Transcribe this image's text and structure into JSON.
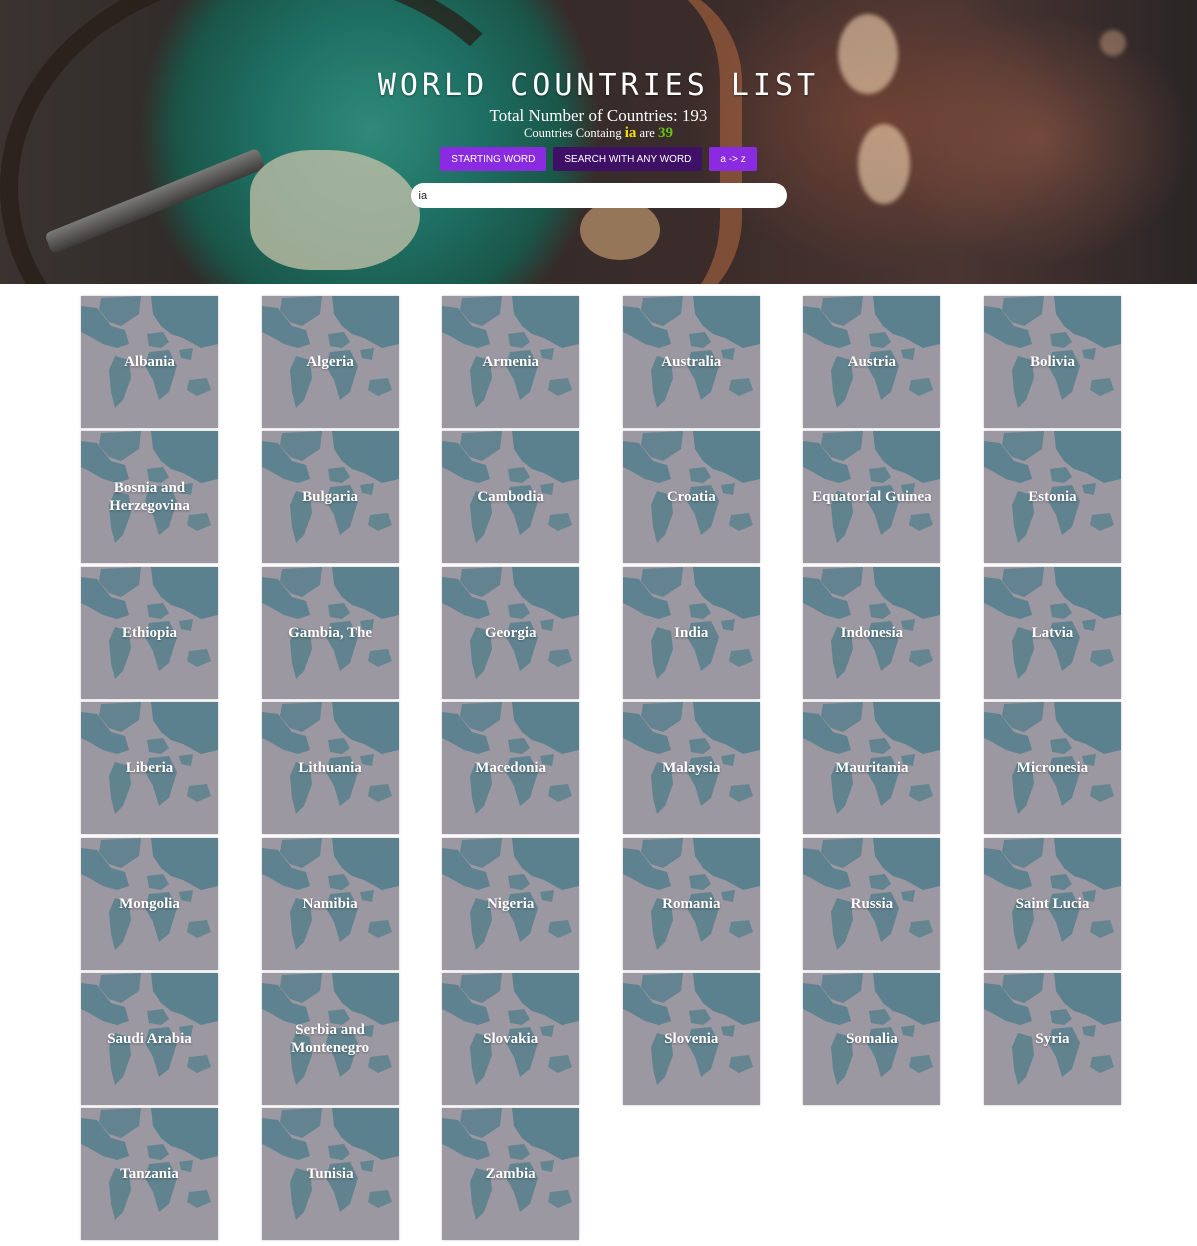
{
  "header": {
    "title": "WORLD COUNTRIES LIST",
    "total_label": "Total Number of Countries: 193",
    "contain_prefix": "Countries Containg",
    "contain_term": "ia",
    "contain_mid": "are",
    "contain_count": "39"
  },
  "buttons": {
    "starting": "STARTING WORD",
    "any": "SEARCH WITH ANY WORD",
    "sort": "a -> z"
  },
  "search": {
    "value": "ia"
  },
  "colors": {
    "accent": "#8a2be2",
    "dark_button": "#3f1166",
    "term": "#f5e100",
    "count": "#63c515"
  },
  "countries": [
    "Albania",
    "Algeria",
    "Armenia",
    "Australia",
    "Austria",
    "Bolivia",
    "Bosnia and Herzegovina",
    "Bulgaria",
    "Cambodia",
    "Croatia",
    "Equatorial Guinea",
    "Estonia",
    "Ethiopia",
    "Gambia, The",
    "Georgia",
    "India",
    "Indonesia",
    "Latvia",
    "Liberia",
    "Lithuania",
    "Macedonia",
    "Malaysia",
    "Mauritania",
    "Micronesia",
    "Mongolia",
    "Namibia",
    "Nigeria",
    "Romania",
    "Russia",
    "Saint Lucia",
    "Saudi Arabia",
    "Serbia and Montenegro",
    "Slovakia",
    "Slovenia",
    "Somalia",
    "Syria",
    "Tanzania",
    "Tunisia",
    "Zambia"
  ]
}
